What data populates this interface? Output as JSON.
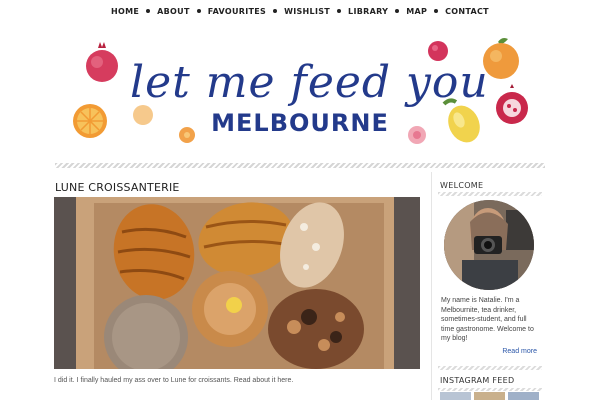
{
  "nav": {
    "items": [
      "HOME",
      "ABOUT",
      "FAVOURITES",
      "WISHLIST",
      "LIBRARY",
      "MAP",
      "CONTACT"
    ]
  },
  "header": {
    "script_title": "let me feed you",
    "subtitle": "MELBOURNE"
  },
  "post": {
    "title": "LUNE CROISSANTERIE",
    "excerpt": "I did it. I finally hauled my ass over to Lune for croissants. Read about it here."
  },
  "sidebar": {
    "welcome_title": "WELCOME",
    "bio": "My name is Natalie. I'm a Melbournite, tea drinker, sometimes-student, and full time gastronome. Welcome to my blog!",
    "read_more": "Read more",
    "instagram_title": "INSTAGRAM FEED"
  },
  "colors": {
    "title_blue": "#233a8b",
    "link_blue": "#2a56a8"
  }
}
